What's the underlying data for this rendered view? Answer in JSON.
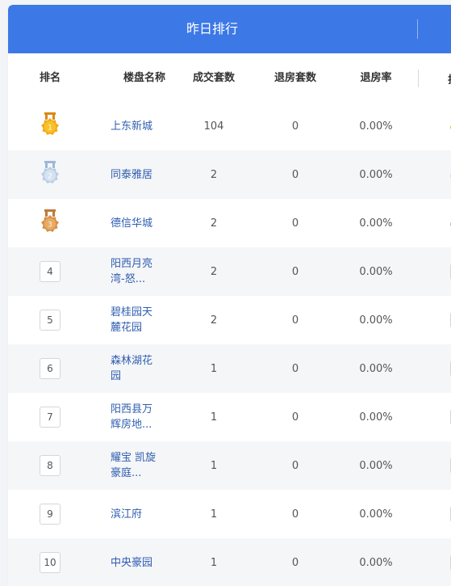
{
  "header": {
    "title": "昨日排行"
  },
  "columns": {
    "rank": "排名",
    "name": "楼盘名称",
    "deals": "成交套数",
    "refunds": "退房套数",
    "refund_rate": "退房率",
    "next_partial": "排"
  },
  "colors": {
    "header_bg": "#3c78e6",
    "link": "#2f5eb0",
    "gold": "#f5b91e",
    "silver": "#c8d8ea",
    "bronze": "#e2a45c"
  },
  "rows": [
    {
      "rank": "1",
      "medal": "gold-medal-icon",
      "name": "上东新城",
      "deals": "104",
      "refunds": "0",
      "rate": "0.00%"
    },
    {
      "rank": "2",
      "medal": "silver-medal-icon",
      "name": "同泰雅居",
      "deals": "2",
      "refunds": "0",
      "rate": "0.00%"
    },
    {
      "rank": "3",
      "medal": "bronze-medal-icon",
      "name": "德信华城",
      "deals": "2",
      "refunds": "0",
      "rate": "0.00%"
    },
    {
      "rank": "4",
      "name": "阳西月亮湾-怒...",
      "deals": "2",
      "refunds": "0",
      "rate": "0.00%"
    },
    {
      "rank": "5",
      "name": "碧桂园天麓花园",
      "deals": "2",
      "refunds": "0",
      "rate": "0.00%"
    },
    {
      "rank": "6",
      "name": "森林湖花园",
      "deals": "1",
      "refunds": "0",
      "rate": "0.00%"
    },
    {
      "rank": "7",
      "name": "阳西县万辉房地...",
      "deals": "1",
      "refunds": "0",
      "rate": "0.00%"
    },
    {
      "rank": "8",
      "name": "耀宝 凯旋豪庭...",
      "deals": "1",
      "refunds": "0",
      "rate": "0.00%"
    },
    {
      "rank": "9",
      "name": "滨江府",
      "deals": "1",
      "refunds": "0",
      "rate": "0.00%"
    },
    {
      "rank": "10",
      "name": "中央豪园",
      "deals": "1",
      "refunds": "0",
      "rate": "0.00%"
    }
  ]
}
